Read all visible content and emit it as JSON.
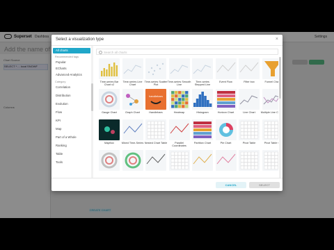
{
  "app": {
    "brand": "Superset",
    "nav_dashboards": "Dashboa",
    "settings": "Settings",
    "title": "Add the name of the",
    "left_panel": {
      "chart_source": "Chart Source",
      "dataset": "SELECT * ... local SNOWF",
      "metrics_label": "Columns"
    },
    "create_chart": "CREATE CHART"
  },
  "modal": {
    "title": "Select a visualization type",
    "close": "×",
    "search_placeholder": "Search all charts",
    "sidebar": {
      "all_charts": "All charts",
      "recommended_tags": "Recommended tags",
      "tags": [
        "Popular",
        "ECharts",
        "Advanced-Analytics"
      ],
      "category": "Category",
      "categories": [
        "Correlation",
        "Distribution",
        "Evolution",
        "Flow",
        "KPI",
        "Map",
        "Part of a Whole",
        "Ranking",
        "Table",
        "Tools"
      ]
    },
    "charts": [
      {
        "label": "Time-series Bar Chart v2",
        "icon": "bar-icon",
        "color": "#e0c040"
      },
      {
        "label": "Time-series Line Chart",
        "icon": "line-icon",
        "color": "#c8d4e0"
      },
      {
        "label": "Time-series Scatter Plot",
        "icon": "scatter-icon",
        "color": "#c8d4e0"
      },
      {
        "label": "Time-series Smooth Line",
        "icon": "line-icon",
        "color": "#c8d4e0"
      },
      {
        "label": "Time-series Stepped Line",
        "icon": "line-icon",
        "color": "#c8d4e0"
      },
      {
        "label": "Event Flow",
        "icon": "flow-icon",
        "color": "#d0d0d0"
      },
      {
        "label": "Filter box",
        "icon": "filter-icon",
        "color": "#d0d0d0"
      },
      {
        "label": "Funnel Chart",
        "icon": "funnel-icon",
        "color": "#e8a030"
      },
      {
        "label": "Gauge Chart",
        "icon": "gauge-icon",
        "color": "#c8d4e0"
      },
      {
        "label": "Graph Chart",
        "icon": "graph-icon",
        "color": "#c060c0"
      },
      {
        "label": "Handlebars",
        "icon": "handlebars-icon",
        "color": "#e87030"
      },
      {
        "label": "Heatmap",
        "icon": "heatmap-icon",
        "color": "#50a870"
      },
      {
        "label": "Histogram",
        "icon": "histogram-icon",
        "color": "#3070c0"
      },
      {
        "label": "Horizon Chart",
        "icon": "horizon-icon",
        "color": "#c03040"
      },
      {
        "label": "Line Chart",
        "icon": "line-icon",
        "color": "#9090a0"
      },
      {
        "label": "Multiple Line Charts",
        "icon": "multiline-icon",
        "color": "#9090a0"
      },
      {
        "label": "MapBox",
        "icon": "map-icon",
        "color": "#106060"
      },
      {
        "label": "Mixed Time-Series",
        "icon": "mixed-icon",
        "color": "#6080c0"
      },
      {
        "label": "Nested Chart Table",
        "icon": "table-icon",
        "color": "#a0a0a0"
      },
      {
        "label": "Parallel Coordinates",
        "icon": "parallel-icon",
        "color": "#d04040"
      },
      {
        "label": "Partition Chart",
        "icon": "partition-icon",
        "color": "#d04080"
      },
      {
        "label": "Pie Chart",
        "icon": "pie-icon",
        "color": "#e04060"
      },
      {
        "label": "Pivot Table",
        "icon": "pivot-icon",
        "color": "#a0a0a0"
      },
      {
        "label": "Pivot Table v2",
        "icon": "pivot-icon",
        "color": "#a0a0a0"
      },
      {
        "label": "",
        "icon": "radar-icon",
        "color": "#c0c0c0"
      },
      {
        "label": "",
        "icon": "sunburst-icon",
        "color": "#60c080"
      },
      {
        "label": "",
        "icon": "box-icon",
        "color": "#606060"
      },
      {
        "label": "",
        "icon": "calendar-icon",
        "color": "#a0a0a0"
      },
      {
        "label": "",
        "icon": "rose-icon",
        "color": "#e0b050"
      },
      {
        "label": "",
        "icon": "sankey-icon",
        "color": "#e080a0"
      },
      {
        "label": "",
        "icon": "table-icon",
        "color": "#a0a0a0"
      },
      {
        "label": "",
        "icon": "treemap-icon",
        "color": "#a0a0a0"
      }
    ],
    "cancel": "CANCEL",
    "select": "SELECT"
  }
}
